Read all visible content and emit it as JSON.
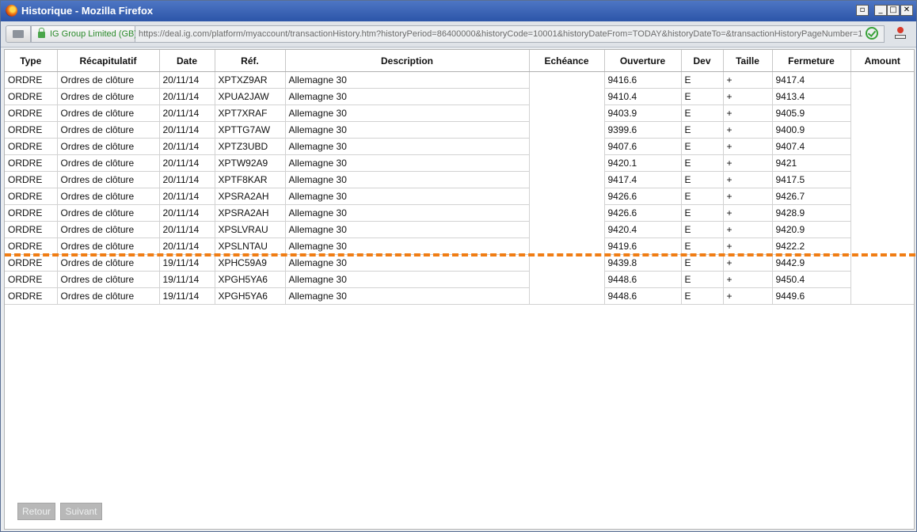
{
  "window": {
    "title": "Historique - Mozilla Firefox",
    "controls": {
      "restore": "▫",
      "minimize": "_",
      "maximize": "□",
      "close": "✕"
    }
  },
  "urlbar": {
    "identity": "IG Group Limited (GB)",
    "url": "https://deal.ig.com/platform/myaccount/transactionHistory.htm?historyPeriod=86400000&historyCode=10001&historyDateFrom=TODAY&historyDateTo=&transactionHistoryPageNumber=1"
  },
  "table": {
    "headers": [
      "Type",
      "Récapitulatif",
      "Date",
      "Réf.",
      "Description",
      "Echéance",
      "Ouverture",
      "Dev",
      "Taille",
      "Fermeture",
      "Amount"
    ],
    "rows": [
      [
        "ORDRE",
        "Ordres de clôture",
        "20/11/14",
        "XPTXZ9AR",
        "Allemagne 30",
        "",
        "9416.6",
        "E",
        "+",
        "9417.4",
        ""
      ],
      [
        "ORDRE",
        "Ordres de clôture",
        "20/11/14",
        "XPUA2JAW",
        "Allemagne 30",
        "",
        "9410.4",
        "E",
        "+",
        "9413.4",
        ""
      ],
      [
        "ORDRE",
        "Ordres de clôture",
        "20/11/14",
        "XPT7XRAF",
        "Allemagne 30",
        "",
        "9403.9",
        "E",
        "+",
        "9405.9",
        ""
      ],
      [
        "ORDRE",
        "Ordres de clôture",
        "20/11/14",
        "XPTTG7AW",
        "Allemagne 30",
        "",
        "9399.6",
        "E",
        "+",
        "9400.9",
        ""
      ],
      [
        "ORDRE",
        "Ordres de clôture",
        "20/11/14",
        "XPTZ3UBD",
        "Allemagne 30",
        "",
        "9407.6",
        "E",
        "+",
        "9407.4",
        ""
      ],
      [
        "ORDRE",
        "Ordres de clôture",
        "20/11/14",
        "XPTW92A9",
        "Allemagne 30",
        "",
        "9420.1",
        "E",
        "+",
        "9421",
        ""
      ],
      [
        "ORDRE",
        "Ordres de clôture",
        "20/11/14",
        "XPTF8KAR",
        "Allemagne 30",
        "",
        "9417.4",
        "E",
        "+",
        "9417.5",
        ""
      ],
      [
        "ORDRE",
        "Ordres de clôture",
        "20/11/14",
        "XPSRA2AH",
        "Allemagne 30",
        "",
        "9426.6",
        "E",
        "+",
        "9426.7",
        ""
      ],
      [
        "ORDRE",
        "Ordres de clôture",
        "20/11/14",
        "XPSRA2AH",
        "Allemagne 30",
        "",
        "9426.6",
        "E",
        "+",
        "9428.9",
        ""
      ],
      [
        "ORDRE",
        "Ordres de clôture",
        "20/11/14",
        "XPSLVRAU",
        "Allemagne 30",
        "",
        "9420.4",
        "E",
        "+",
        "9420.9",
        ""
      ],
      [
        "ORDRE",
        "Ordres de clôture",
        "20/11/14",
        "XPSLNTAU",
        "Allemagne 30",
        "",
        "9419.6",
        "E",
        "+",
        "9422.2",
        ""
      ],
      [
        "ORDRE",
        "Ordres de clôture",
        "19/11/14",
        "XPHC59A9",
        "Allemagne 30",
        "",
        "9439.8",
        "E",
        "+",
        "9442.9",
        ""
      ],
      [
        "ORDRE",
        "Ordres de clôture",
        "19/11/14",
        "XPGH5YA6",
        "Allemagne 30",
        "",
        "9448.6",
        "E",
        "+",
        "9450.4",
        ""
      ],
      [
        "ORDRE",
        "Ordres de clôture",
        "19/11/14",
        "XPGH5YA6",
        "Allemagne 30",
        "",
        "9448.6",
        "E",
        "+",
        "9449.6",
        ""
      ]
    ]
  },
  "annotation": {
    "separator_color": "#f07d14"
  },
  "pager": {
    "prev": "Retour",
    "next": "Suivant"
  }
}
